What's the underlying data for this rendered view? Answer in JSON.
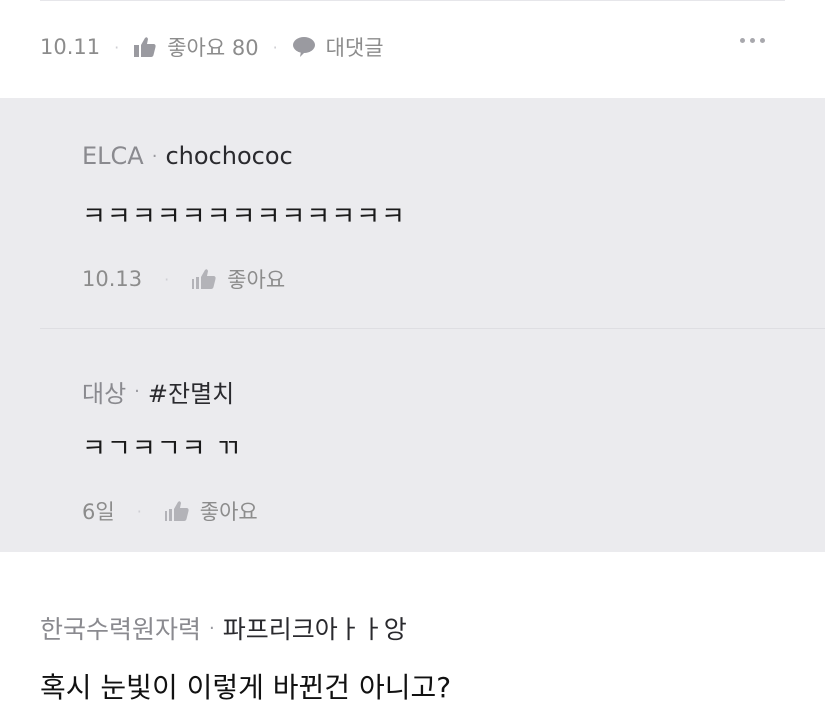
{
  "comment": {
    "date": "10.11",
    "like_label": "좋아요 80",
    "reply_label": "대댓글"
  },
  "replies": [
    {
      "badge": "ELCA",
      "name": "chochococ",
      "text": "ㅋㅋㅋㅋㅋㅋㅋㅋㅋㅋㅋㅋㅋ",
      "date": "10.13",
      "like_label": "좋아요"
    },
    {
      "badge": "대상",
      "name": "#잔멸치",
      "text": "ㅋㄱㅋㄱㅋ ㄲ",
      "date": "6일",
      "like_label": "좋아요"
    }
  ],
  "next_comment": {
    "badge": "한국수력원자력",
    "name": "파프리크아ㅏㅏ앙",
    "text": "혹시 눈빛이 이렇게 바뀐건 아니고?"
  },
  "separator": "·",
  "icons": {
    "like": "thumbs-up-icon",
    "reply": "speech-bubble-icon",
    "more": "more-dots-icon"
  },
  "colors": {
    "reply_background": "#ebebee",
    "meta_text": "#8c8c8c"
  }
}
